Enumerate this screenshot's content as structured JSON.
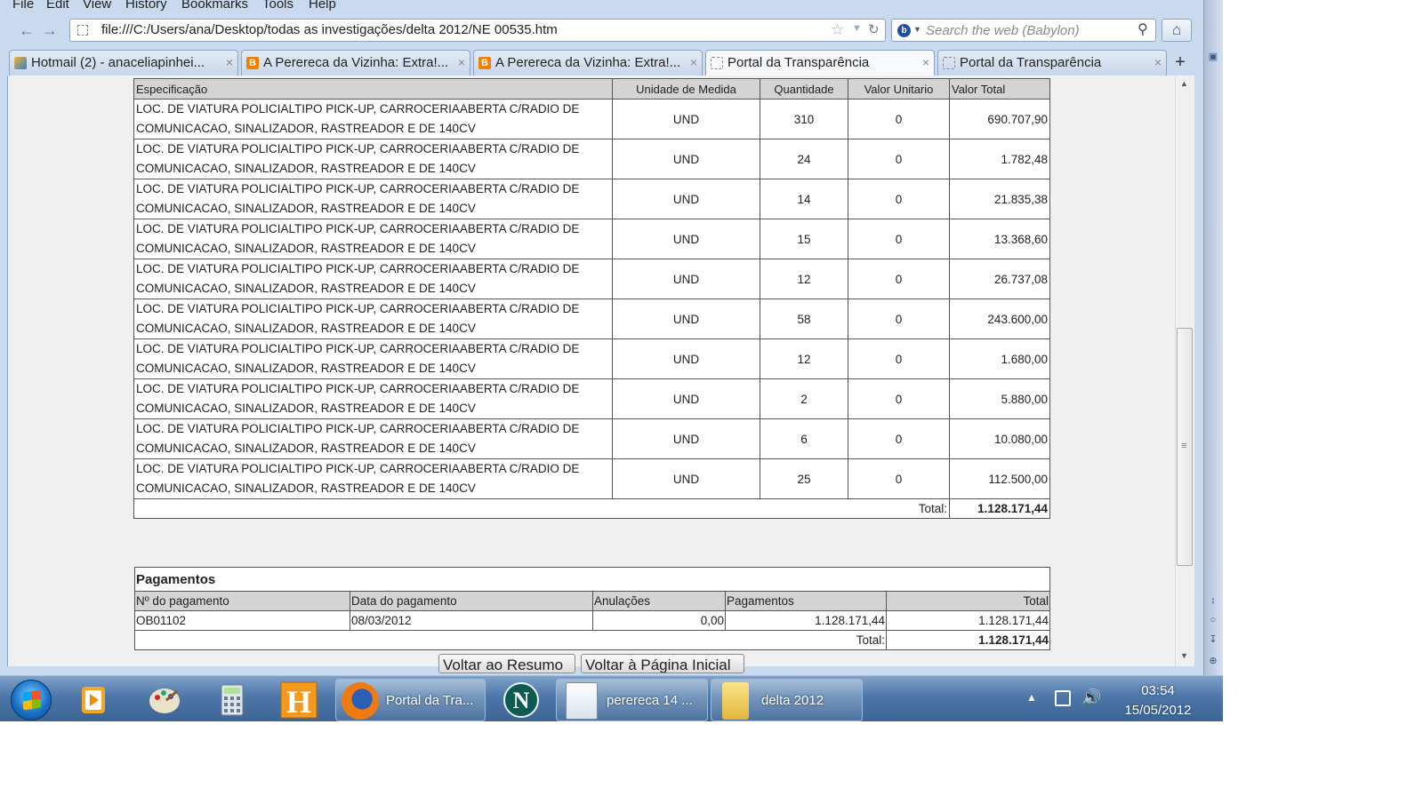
{
  "menu": [
    "File",
    "Edit",
    "View",
    "History",
    "Bookmarks",
    "Tools",
    "Help"
  ],
  "url": "file:///C:/Users/ana/Desktop/todas as investigações/delta 2012/NE 00535.htm",
  "search": {
    "placeholder": "Search the web (Babylon)"
  },
  "tabs": [
    {
      "label": "Hotmail (2) - anaceliapinhei...",
      "icon": "hotmail-icon"
    },
    {
      "label": "A Perereca da Vizinha: Extra!...",
      "icon": "blogger-icon"
    },
    {
      "label": "A Perereca da Vizinha: Extra!...",
      "icon": "blogger-icon"
    },
    {
      "label": "Portal da Transparência",
      "icon": "blank-page-icon",
      "active": true
    },
    {
      "label": "Portal da Transparência",
      "icon": "blank-page-icon"
    }
  ],
  "items_table": {
    "headers": [
      "Especificação",
      "Unidade de Medida",
      "Quantidade",
      "Valor Unitario",
      "Valor Total"
    ],
    "rows": [
      {
        "spec": "LOC. DE VIATURA POLICIALTIPO PICK-UP, CARROCERIAABERTA C/RADIO DE COMUNICACAO, SINALIZADOR, RASTREADOR E DE 140CV",
        "unit": "UND",
        "qty": "310",
        "unit_value": "0",
        "total": "690.707,90"
      },
      {
        "spec": "LOC. DE VIATURA POLICIALTIPO PICK-UP, CARROCERIAABERTA C/RADIO DE COMUNICACAO, SINALIZADOR, RASTREADOR E DE 140CV",
        "unit": "UND",
        "qty": "24",
        "unit_value": "0",
        "total": "1.782,48"
      },
      {
        "spec": "LOC. DE VIATURA POLICIALTIPO PICK-UP, CARROCERIAABERTA C/RADIO DE COMUNICACAO, SINALIZADOR, RASTREADOR E DE 140CV",
        "unit": "UND",
        "qty": "14",
        "unit_value": "0",
        "total": "21.835,38"
      },
      {
        "spec": "LOC. DE VIATURA POLICIALTIPO PICK-UP, CARROCERIAABERTA C/RADIO DE COMUNICACAO, SINALIZADOR, RASTREADOR E DE 140CV",
        "unit": "UND",
        "qty": "15",
        "unit_value": "0",
        "total": "13.368,60"
      },
      {
        "spec": "LOC. DE VIATURA POLICIALTIPO PICK-UP, CARROCERIAABERTA C/RADIO DE COMUNICACAO, SINALIZADOR, RASTREADOR E DE 140CV",
        "unit": "UND",
        "qty": "12",
        "unit_value": "0",
        "total": "26.737,08"
      },
      {
        "spec": "LOC. DE VIATURA POLICIALTIPO PICK-UP, CARROCERIAABERTA C/RADIO DE COMUNICACAO, SINALIZADOR, RASTREADOR E DE 140CV",
        "unit": "UND",
        "qty": "58",
        "unit_value": "0",
        "total": "243.600,00"
      },
      {
        "spec": "LOC. DE VIATURA POLICIALTIPO PICK-UP, CARROCERIAABERTA C/RADIO DE COMUNICACAO, SINALIZADOR, RASTREADOR E DE 140CV",
        "unit": "UND",
        "qty": "12",
        "unit_value": "0",
        "total": "1.680,00"
      },
      {
        "spec": "LOC. DE VIATURA POLICIALTIPO PICK-UP, CARROCERIAABERTA C/RADIO DE COMUNICACAO, SINALIZADOR, RASTREADOR E DE 140CV",
        "unit": "UND",
        "qty": "2",
        "unit_value": "0",
        "total": "5.880,00"
      },
      {
        "spec": "LOC. DE VIATURA POLICIALTIPO PICK-UP, CARROCERIAABERTA C/RADIO DE COMUNICACAO, SINALIZADOR, RASTREADOR E DE 140CV",
        "unit": "UND",
        "qty": "6",
        "unit_value": "0",
        "total": "10.080,00"
      },
      {
        "spec": "LOC. DE VIATURA POLICIALTIPO PICK-UP, CARROCERIAABERTA C/RADIO DE COMUNICACAO, SINALIZADOR, RASTREADOR E DE 140CV",
        "unit": "UND",
        "qty": "25",
        "unit_value": "0",
        "total": "112.500,00"
      }
    ],
    "total_label": "Total:",
    "total_value": "1.128.171,44"
  },
  "payments": {
    "title": "Pagamentos",
    "headers": [
      "Nº do pagamento",
      "Data do pagamento",
      "Anulações",
      "Pagamentos",
      "Total"
    ],
    "rows": [
      {
        "number": "OB01102",
        "date": "08/03/2012",
        "annulments": "0,00",
        "payments": "1.128.171,44",
        "total": "1.128.171,44"
      }
    ],
    "total_label": "Total:",
    "total_value": "1.128.171,44"
  },
  "buttons": {
    "back_summary": "Voltar ao Resumo",
    "back_home": "Voltar à Página Inicial"
  },
  "taskbar": {
    "items": [
      {
        "label": "Portal da Tra...",
        "icon": "firefox-icon"
      },
      {
        "label": "perereca 14 ...",
        "icon": "document-icon"
      },
      {
        "label": "delta 2012",
        "icon": "folder-icon"
      }
    ],
    "clock_time": "03:54",
    "clock_date": "15/05/2012"
  }
}
